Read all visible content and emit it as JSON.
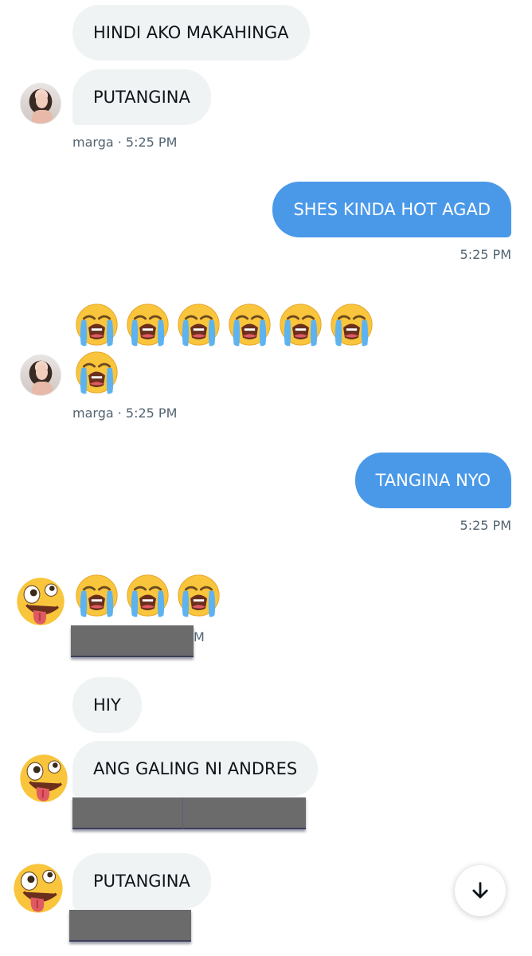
{
  "messages": {
    "m1": "HINDI AKO MAKAHINGA",
    "m2": "PUTANGINA",
    "meta1": "marga · 5:25 PM",
    "out1": "SHES KINDA HOT AGAD",
    "time1": "5:25 PM",
    "meta2": "marga · 5:25 PM",
    "out2": "TANGINA NYO",
    "time2": "5:25 PM",
    "tick": "M",
    "m3": "HIY",
    "m4": "ANG GALING NI ANDRES",
    "m5": "PUTANGINA"
  },
  "icons": {
    "crying_emoji": "loudly-crying-face",
    "zany_emoji": "zany-face",
    "scroll_down": "arrow-down-icon"
  },
  "colors": {
    "incoming_bubble": "#eff3f4",
    "outgoing_bubble": "#4a99e9",
    "meta_text": "#536471",
    "redaction": "#6b6b6b"
  }
}
